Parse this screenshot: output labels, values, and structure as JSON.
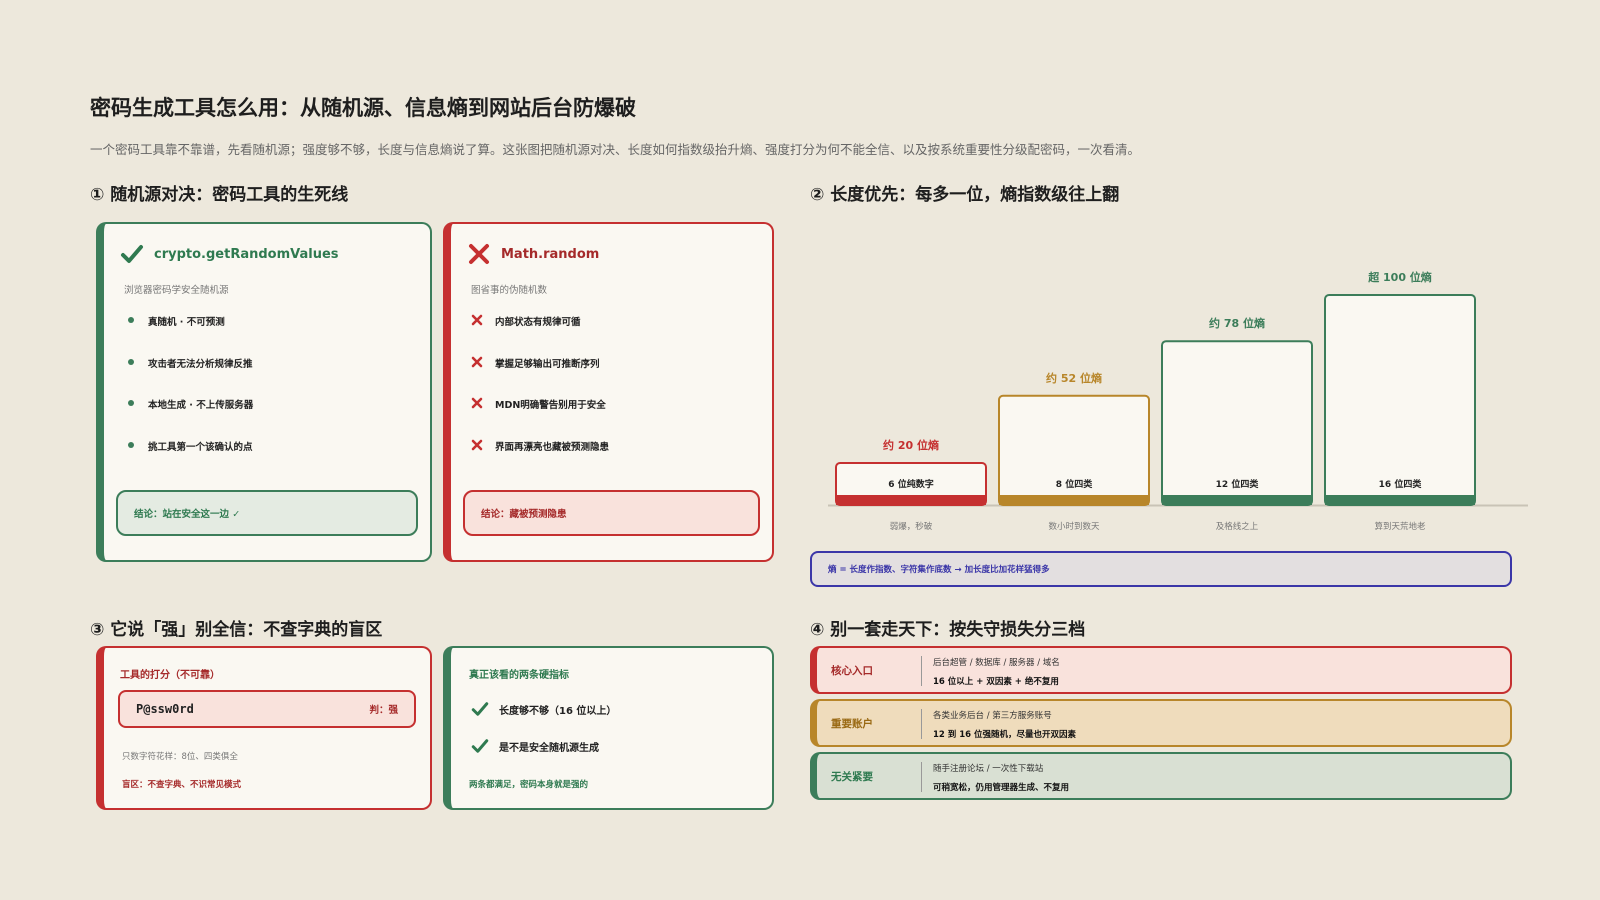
{
  "header": {
    "title": "密码生成工具怎么用：从随机源、信息熵到网站后台防爆破",
    "subtitle": "一个密码工具靠不靠谱，先看随机源；强度够不够，长度与信息熵说了算。这张图把随机源对决、长度如何指数级抬升熵、强度打分为何不能全信、以及按系统重要性分级配密码，一次看清。"
  },
  "section1": {
    "title": "① 随机源对决：密码工具的生死线",
    "good": {
      "name": "crypto.getRandomValues",
      "desc": "浏览器密码学安全随机源",
      "points": [
        "真随机 · 不可预测",
        "攻击者无法分析规律反推",
        "本地生成 · 不上传服务器",
        "挑工具第一个该确认的点"
      ],
      "conclusion": "结论：站在安全这一边 ✓"
    },
    "bad": {
      "name": "Math.random",
      "desc": "图省事的伪随机数",
      "points": [
        "内部状态有规律可循",
        "掌握足够输出可推断序列",
        "MDN明确警告别用于安全",
        "界面再漂亮也藏被预测隐患"
      ],
      "conclusion": "结论：藏被预测隐患"
    }
  },
  "section2": {
    "title": "② 长度优先：每多一位，熵指数级往上翻",
    "note": "熵 = 长度作指数、字符集作底数 → 加长度比加花样猛得多"
  },
  "chart_data": {
    "type": "bar",
    "categories": [
      "6 位纯数字",
      "8 位四类",
      "12 位四类",
      "16 位四类"
    ],
    "value_labels": [
      "约 20 位熵",
      "约 52 位熵",
      "约 78 位熵",
      "超 100 位熵"
    ],
    "values": [
      20,
      52,
      78,
      100
    ],
    "descriptions": [
      "弱爆，秒破",
      "数小时到数天",
      "及格线之上",
      "算到天荒地老"
    ],
    "colors": [
      "#c53030",
      "#b8862a",
      "#3c7d5a",
      "#3c7d5a"
    ]
  },
  "section3": {
    "title": "③ 它说「强」别全信：不查字典的盲区",
    "left": {
      "title": "工具的打分（不可靠）",
      "password": "P@ssw0rd",
      "verdict": "判：强",
      "note": "只数字符花样：8位、四类俱全",
      "blind": "盲区：不查字典、不识常见模式"
    },
    "right": {
      "title": "真正该看的两条硬指标",
      "checks": [
        "长度够不够（16 位以上）",
        "是不是安全随机源生成"
      ],
      "footer": "两条都满足，密码本身就是强的"
    }
  },
  "section4": {
    "title": "④ 别一套走天下：按失守损失分三档",
    "tiers": [
      {
        "name": "核心入口",
        "examples": "后台超管 / 数据库 / 服务器 / 域名",
        "rule": "16 位以上 + 双因素 + 绝不复用"
      },
      {
        "name": "重要账户",
        "examples": "各类业务后台 / 第三方服务账号",
        "rule": "12 到 16 位强随机，尽量也开双因素"
      },
      {
        "name": "无关紧要",
        "examples": "随手注册论坛 / 一次性下载站",
        "rule": "可稍宽松，仍用管理器生成、不复用"
      }
    ]
  }
}
